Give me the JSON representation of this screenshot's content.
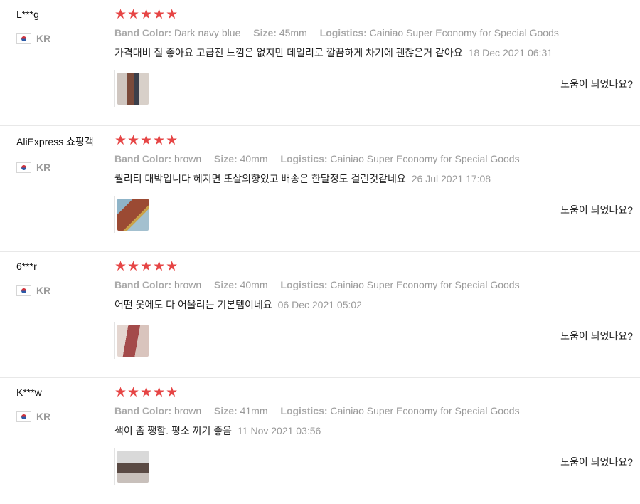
{
  "reviews": [
    {
      "user": "L***g",
      "country": "KR",
      "stars": "★★★★★",
      "attrs": [
        {
          "label": "Band Color:",
          "value": "Dark navy blue"
        },
        {
          "label": "Size:",
          "value": "45mm"
        },
        {
          "label": "Logistics:",
          "value": "Cainiao Super Economy for Special Goods"
        }
      ],
      "text": "가격대비 질 좋아요 고급진 느낌은 없지만 데일리로 깔끔하게 차기에 괜찮은거 같아요",
      "date": "18 Dec 2021 06:31",
      "helpful": "도움이 되었나요?"
    },
    {
      "user": "AliExpress 쇼핑객",
      "country": "KR",
      "stars": "★★★★★",
      "attrs": [
        {
          "label": "Band Color:",
          "value": "brown"
        },
        {
          "label": "Size:",
          "value": "40mm"
        },
        {
          "label": "Logistics:",
          "value": "Cainiao Super Economy for Special Goods"
        }
      ],
      "text": "퀄리티 대박입니다 헤지면 또살의향있고 배송은 한달정도 걸린것같네요",
      "date": "26 Jul 2021 17:08",
      "helpful": "도움이 되었나요?"
    },
    {
      "user": "6***r",
      "country": "KR",
      "stars": "★★★★★",
      "attrs": [
        {
          "label": "Band Color:",
          "value": "brown"
        },
        {
          "label": "Size:",
          "value": "40mm"
        },
        {
          "label": "Logistics:",
          "value": "Cainiao Super Economy for Special Goods"
        }
      ],
      "text": "어떤 옷에도 다 어울리는 기본템이네요",
      "date": "06 Dec 2021 05:02",
      "helpful": "도움이 되었나요?"
    },
    {
      "user": "K***w",
      "country": "KR",
      "stars": "★★★★★",
      "attrs": [
        {
          "label": "Band Color:",
          "value": "brown"
        },
        {
          "label": "Size:",
          "value": "41mm"
        },
        {
          "label": "Logistics:",
          "value": "Cainiao Super Economy for Special Goods"
        }
      ],
      "text": "색이 좀 쨍함. 평소 끼기 좋음",
      "date": "11 Nov 2021 03:56",
      "helpful": "도움이 되었나요?"
    }
  ]
}
